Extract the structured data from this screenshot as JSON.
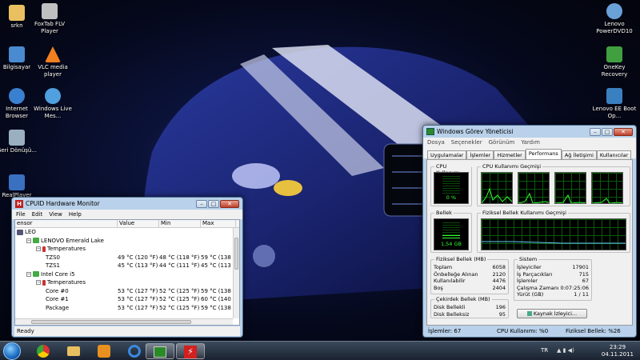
{
  "desktop_icons": [
    {
      "label": "srkn",
      "color": "#e8c060"
    },
    {
      "label": "FoxTab FLV Player",
      "color": "#c0c0c0"
    },
    {
      "label": "Bilgisayar",
      "color": "#4a8ad0"
    },
    {
      "label": "VLC media player",
      "color": "#f08020"
    },
    {
      "label": "Internet Browser",
      "color": "#3a80d0"
    },
    {
      "label": "Windows Live Mes...",
      "color": "#50a0e0"
    },
    {
      "label": "Geri Dönüşü...",
      "color": "#9ab0c0"
    },
    {
      "label": "RealPlayer",
      "color": "#3a70c0"
    },
    {
      "label": "Lenovo PowerDVD10",
      "color": "#6aa0d8"
    },
    {
      "label": "OneKey Recovery",
      "color": "#40a040"
    },
    {
      "label": "Lenovo EE Boot Op...",
      "color": "#3a80c0"
    }
  ],
  "hwmonitor": {
    "title": "CPUID Hardware Monitor",
    "menu": [
      "File",
      "Edit",
      "View",
      "Help"
    ],
    "columns": [
      "ensor",
      "Value",
      "Min",
      "Max"
    ],
    "rows": [
      {
        "indent": 0,
        "name": "LEO",
        "value": "",
        "min": "",
        "max": ""
      },
      {
        "indent": 1,
        "name": "LENOVO Emerald Lake",
        "value": "",
        "min": "",
        "max": ""
      },
      {
        "indent": 2,
        "name": "Temperatures",
        "value": "",
        "min": "",
        "max": ""
      },
      {
        "indent": 3,
        "name": "TZS0",
        "value": "49 °C  (120 °F)",
        "min": "48 °C  (118 °F)",
        "max": "59 °C  (138 °"
      },
      {
        "indent": 3,
        "name": "TZS1",
        "value": "45 °C  (113 °F)",
        "min": "44 °C  (111 °F)",
        "max": "45 °C  (113 °"
      },
      {
        "indent": 1,
        "name": "Intel Core i5",
        "value": "",
        "min": "",
        "max": ""
      },
      {
        "indent": 2,
        "name": "Temperatures",
        "value": "",
        "min": "",
        "max": ""
      },
      {
        "indent": 3,
        "name": "Core #0",
        "value": "53 °C  (127 °F)",
        "min": "52 °C  (125 °F)",
        "max": "59 °C  (138 °"
      },
      {
        "indent": 3,
        "name": "Core #1",
        "value": "53 °C  (127 °F)",
        "min": "52 °C  (125 °F)",
        "max": "60 °C  (140 °"
      },
      {
        "indent": 3,
        "name": "Package",
        "value": "53 °C  (127 °F)",
        "min": "52 °C  (125 °F)",
        "max": "59 °C  (138 °"
      }
    ],
    "status": "Ready"
  },
  "taskmgr": {
    "title": "Windows Görev Yöneticisi",
    "menu": [
      "Dosya",
      "Seçenekler",
      "Görünüm",
      "Yardım"
    ],
    "tabs": [
      "Uygulamalar",
      "İşlemler",
      "Hizmetler",
      "Performans",
      "Ağ İletişimi",
      "Kullanıcılar"
    ],
    "active_tab": "Performans",
    "cpu_usage_title": "CPU Kullanımı",
    "cpu_usage_value": "0 %",
    "cpu_history_title": "CPU Kullanımı Geçmişi",
    "memory_title": "Bellek",
    "memory_value": "1,54 GB",
    "memory_fraction": 0.26,
    "mem_history_title": "Fiziksel Bellek Kullanımı Geçmişi",
    "physical_memory": {
      "title": "Fiziksel Bellek (MB)",
      "rows": [
        [
          "Toplam",
          "6058"
        ],
        [
          "Önbelleğe Alınan",
          "2120"
        ],
        [
          "Kullanılabilir",
          "4476"
        ],
        [
          "Boş",
          "2404"
        ]
      ]
    },
    "kernel_memory": {
      "title": "Çekirdek Bellek (MB)",
      "rows": [
        [
          "Disk Bellekli",
          "196"
        ],
        [
          "Disk Belleksiz",
          "95"
        ]
      ]
    },
    "system": {
      "title": "Sistem",
      "rows": [
        [
          "İşleyiciler",
          "17901"
        ],
        [
          "İş Parçacıkları",
          "715"
        ],
        [
          "İşlemler",
          "67"
        ],
        [
          "Çalışma Zamanı",
          "0:07:25:06"
        ],
        [
          "Yürüt (GB)",
          "1 / 11"
        ]
      ]
    },
    "resource_button": "Kaynak İzleyici...",
    "status": [
      "İşlemler: 67",
      "CPU Kullanımı: %0",
      "Fiziksel Bellek: %26"
    ]
  },
  "taskbar": {
    "lang": "TR",
    "time": "23:29",
    "date": "04.11.2011"
  }
}
